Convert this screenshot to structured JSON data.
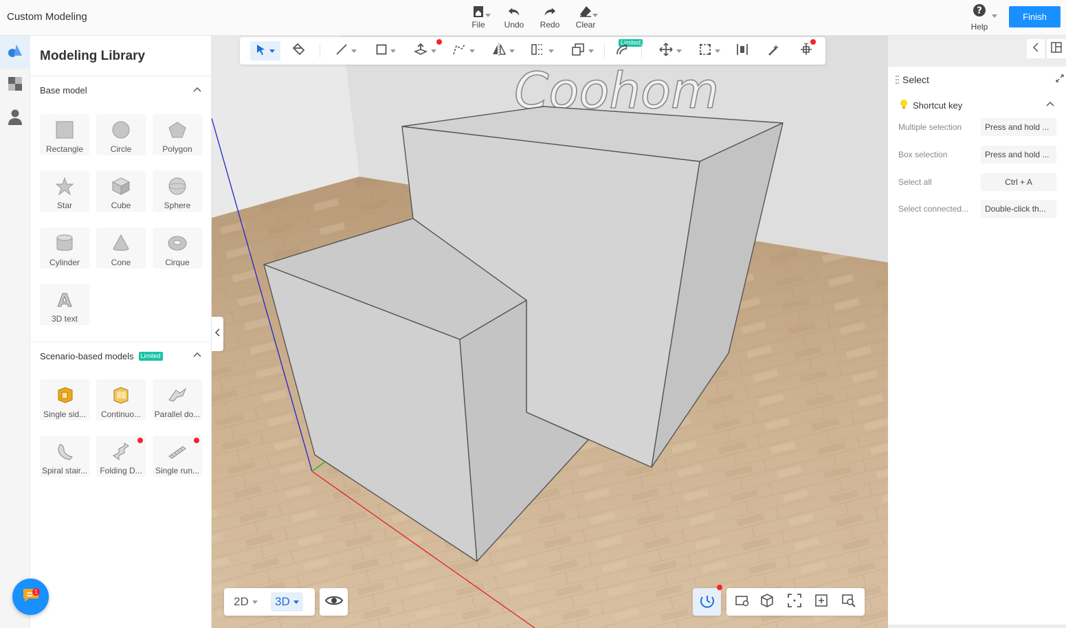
{
  "app": {
    "title": "Custom Modeling"
  },
  "top_tools": [
    {
      "label": "File",
      "icon": "file-icon"
    },
    {
      "label": "Undo",
      "icon": "undo-icon"
    },
    {
      "label": "Redo",
      "icon": "redo-icon"
    },
    {
      "label": "Clear",
      "icon": "eraser-icon"
    }
  ],
  "help": {
    "label": "Help"
  },
  "finish": {
    "label": "Finish"
  },
  "rail": [
    "modeling-library-icon",
    "material-icon",
    "user-icon"
  ],
  "library": {
    "title": "Modeling Library",
    "base_section": "Base model",
    "base_items": [
      "Rectangle",
      "Circle",
      "Polygon",
      "Star",
      "Cube",
      "Sphere",
      "Cylinder",
      "Cone",
      "Cirque",
      "3D text"
    ],
    "scenario_section": "Scenario-based models",
    "scenario_badge": "Limited",
    "scenario_items": [
      "Single sid...",
      "Continuo...",
      "Parallel do...",
      "Spiral stair...",
      "Folding D...",
      "Single run..."
    ]
  },
  "toolbar": {
    "limited_badge": "Limited",
    "tools": [
      "select-arrow-icon",
      "paint-bucket-icon",
      "line-icon",
      "rectangle-draw-icon",
      "push-pull-icon",
      "path-follow-icon",
      "mirror-icon",
      "array-icon",
      "copy-icon",
      "limited-tool-icon",
      "move-icon",
      "scale-icon",
      "align-icon",
      "magic-wand-icon",
      "gizmo-icon"
    ]
  },
  "view_switch": {
    "two_d": "2D",
    "three_d": "3D",
    "active": "3D"
  },
  "scene": {
    "sign_text": "Coohom"
  },
  "select_panel": {
    "title": "Select",
    "shortcut_header": "Shortcut key",
    "shortcuts": [
      {
        "label": "Multiple selection",
        "value": "Press and hold ..."
      },
      {
        "label": "Box selection",
        "value": "Press and hold ..."
      },
      {
        "label": "Select all",
        "value": "Ctrl + A"
      },
      {
        "label": "Select connected...",
        "value": "Double-click th..."
      }
    ]
  },
  "colors": {
    "accent": "#1890ff",
    "limited": "#17c3a2",
    "notify": "#f5222d",
    "floor": "#c9ad8a",
    "wall": "#d9d9d9"
  }
}
